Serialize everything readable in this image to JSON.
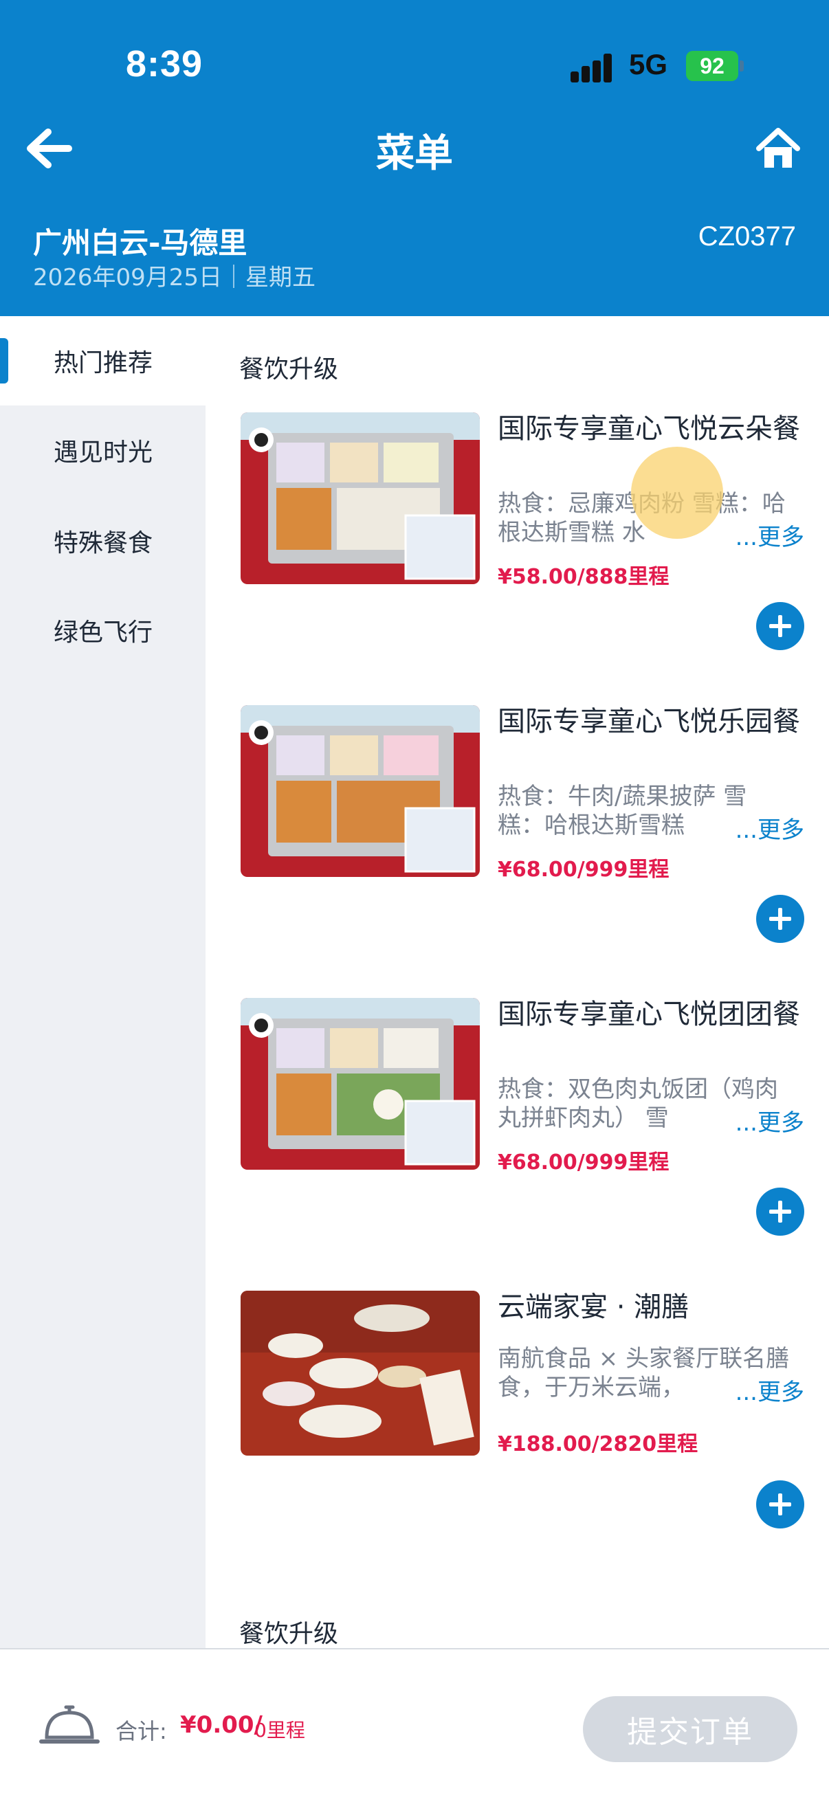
{
  "status": {
    "time": "8:39",
    "network": "5G",
    "battery": "92"
  },
  "header": {
    "title": "菜单",
    "route": "广州白云-马德里",
    "date": "2026年09月25日｜星期五",
    "flight": "CZ0377"
  },
  "sidebar": {
    "items": [
      {
        "label": "热门推荐",
        "active": true
      },
      {
        "label": "遇见时光",
        "active": false
      },
      {
        "label": "特殊餐食",
        "active": false
      },
      {
        "label": "绿色飞行",
        "active": false
      }
    ]
  },
  "main": {
    "section_title": "餐饮升级",
    "section_title_2": "餐饮升级",
    "more_label": "...更多",
    "items": [
      {
        "title": "国际专享童心飞悦云朵餐",
        "desc": "热食：忌廉鸡肉粉 雪糕：哈根达斯雪糕 水",
        "price": "¥58.00/888里程"
      },
      {
        "title": "国际专享童心飞悦乐园餐",
        "desc": "热食：牛肉/蔬果披萨 雪糕：哈根达斯雪糕",
        "price": "¥68.00/999里程"
      },
      {
        "title": "国际专享童心飞悦团团餐",
        "desc": "热食：双色肉丸饭团（鸡肉丸拼虾肉丸） 雪",
        "price": "¥68.00/999里程"
      },
      {
        "title": "云端家宴 · 潮膳",
        "desc": "南航食品 × 头家餐厅联名膳食，于万米云端，",
        "price": "¥188.00/2820里程"
      }
    ]
  },
  "footer": {
    "total_label": "合计:",
    "total_amount": "¥0.00/",
    "total_miles": "0里程",
    "submit_label": "提交订单"
  },
  "colors": {
    "brand": "#0b82cc",
    "price": "#e21b4d",
    "sidebar_bg": "#eef0f4"
  }
}
